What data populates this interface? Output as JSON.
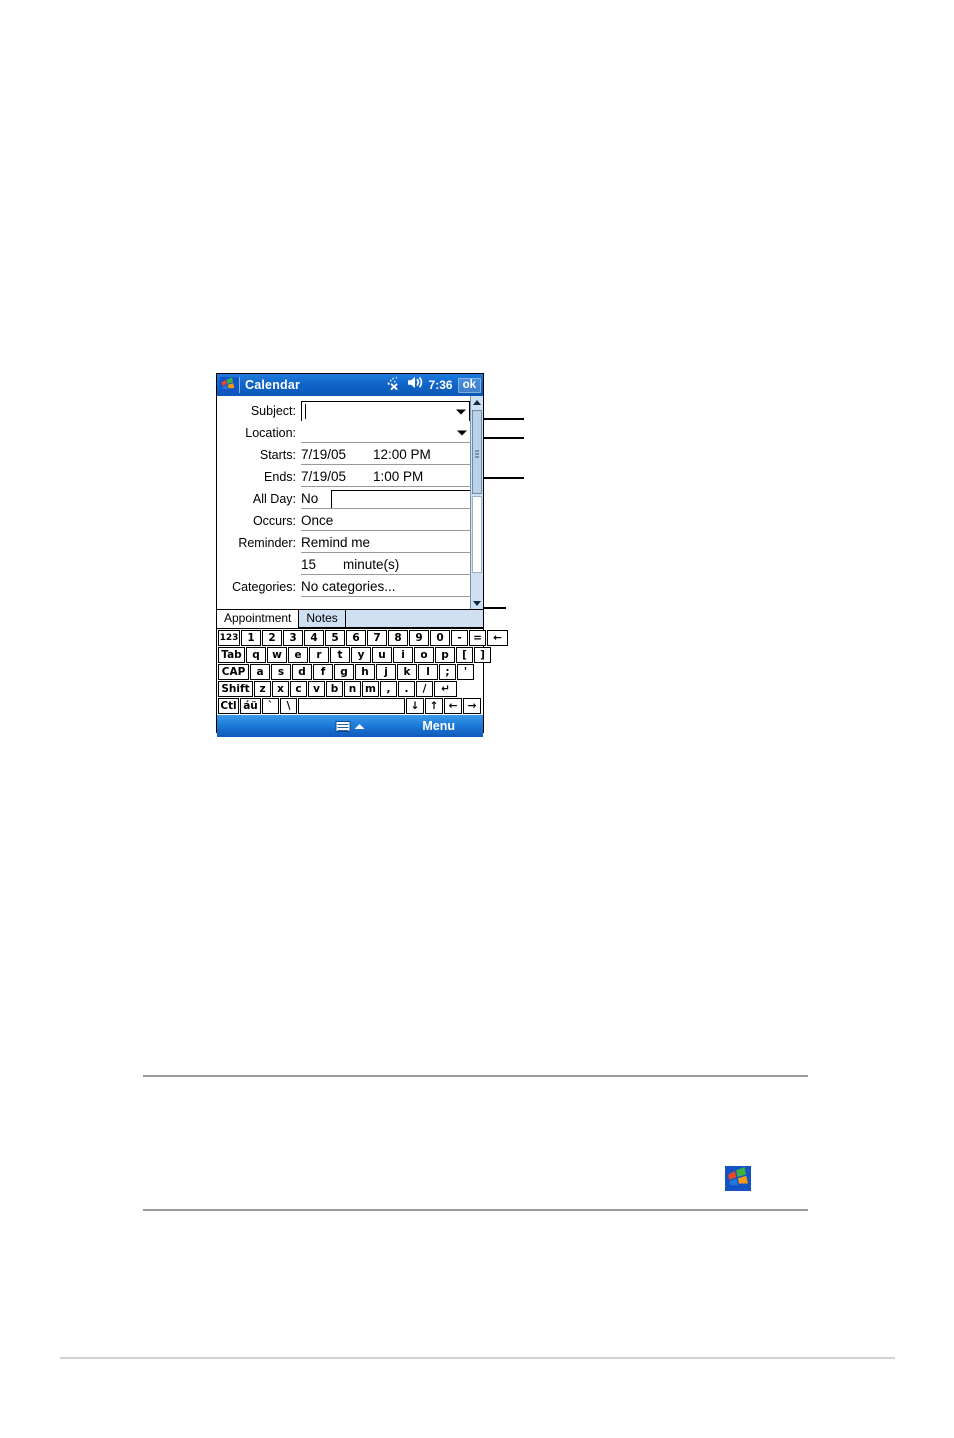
{
  "device": {
    "titlebar": {
      "app_title": "Calendar",
      "logo_icon": "windows-logo-icon",
      "connectivity_icon": "connectivity-disconnected-icon",
      "volume_icon": "speaker-icon",
      "time": "7:36",
      "ok_label": "ok"
    },
    "form": {
      "rows": [
        {
          "label": "Subject:",
          "value": ""
        },
        {
          "label": "Location:",
          "value": ""
        },
        {
          "label": "Starts:",
          "date": "7/19/05",
          "time": "12:00 PM"
        },
        {
          "label": "Ends:",
          "date": "7/19/05",
          "time": "1:00 PM"
        },
        {
          "label": "All Day:",
          "value": "No"
        },
        {
          "label": "Occurs:",
          "value": "Once"
        },
        {
          "label": "Reminder:",
          "value": "Remind me"
        },
        {
          "label": "",
          "amount": "15",
          "unit": "minute(s)"
        },
        {
          "label": "Categories:",
          "value": "No categories..."
        }
      ]
    },
    "tabs": [
      {
        "label": "Appointment",
        "selected": true
      },
      {
        "label": "Notes",
        "selected": false
      }
    ],
    "keyboard": {
      "rows": [
        [
          "123",
          "1",
          "2",
          "3",
          "4",
          "5",
          "6",
          "7",
          "8",
          "9",
          "0",
          "-",
          "=",
          "←"
        ],
        [
          "Tab",
          "q",
          "w",
          "e",
          "r",
          "t",
          "y",
          "u",
          "i",
          "o",
          "p",
          "[",
          "]"
        ],
        [
          "CAP",
          "a",
          "s",
          "d",
          "f",
          "g",
          "h",
          "j",
          "k",
          "l",
          ";",
          "'"
        ],
        [
          "Shift",
          "z",
          "x",
          "c",
          "v",
          "b",
          "n",
          "m",
          ",",
          ".",
          "/",
          "↵"
        ],
        [
          "Ctl",
          "áü",
          "`",
          "\\",
          "",
          "↓",
          "↑",
          "←",
          "→"
        ]
      ]
    },
    "commandbar": {
      "keyboard_icon": "soft-keyboard-icon",
      "expand_icon": "chevron-up-icon",
      "menu_label": "Menu"
    },
    "scrollbar": {
      "up_icon": "scroll-up-arrow-icon",
      "down_icon": "scroll-down-arrow-icon",
      "thumb_icon": "scroll-thumb-grip-icon"
    }
  },
  "page": {
    "body_logo_icon": "windows-logo-icon"
  },
  "colors": {
    "titlebar_blue": "#1165c8",
    "commandbar_blue": "#1a78d8",
    "scrollbar_blue": "#cfe0f2",
    "tab_blue": "#cfe0f2",
    "rule_gray": "#9a9a9a",
    "footer_rule_gray": "#d2d2d2"
  }
}
